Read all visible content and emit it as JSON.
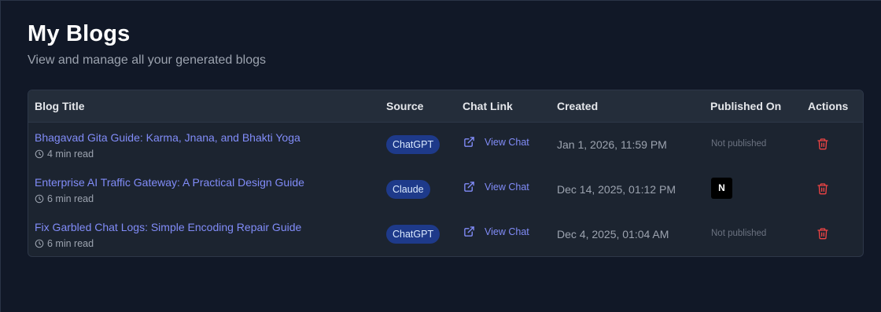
{
  "header": {
    "title": "My Blogs",
    "subtitle": "View and manage all your generated blogs"
  },
  "table": {
    "columns": [
      "Blog Title",
      "Source",
      "Chat Link",
      "Created",
      "Published On",
      "Actions"
    ],
    "rows": [
      {
        "title": "Bhagavad Gita Guide: Karma, Jnana, and Bhakti Yoga",
        "read_time": "4 min read",
        "source": "ChatGPT",
        "chat_link": "View Chat",
        "created": "Jan 1, 2026, 11:59 PM",
        "published": "Not published"
      },
      {
        "title": "Enterprise AI Traffic Gateway: A Practical Design Guide",
        "read_time": "6 min read",
        "source": "Claude",
        "chat_link": "View Chat",
        "created": "Dec 14, 2025, 01:12 PM",
        "published": "N"
      },
      {
        "title": "Fix Garbled Chat Logs: Simple Encoding Repair Guide",
        "read_time": "6 min read",
        "source": "ChatGPT",
        "chat_link": "View Chat",
        "created": "Dec 4, 2025, 01:04 AM",
        "published": "Not published"
      }
    ]
  },
  "icons": {
    "clock": "clock-icon",
    "external_link": "external-link-icon",
    "trash": "trash-icon",
    "notion": "notion-logo"
  },
  "colors": {
    "background": "#111827",
    "link": "#818cf8",
    "badge_bg": "#1e3a8a",
    "danger": "#ef4444"
  }
}
